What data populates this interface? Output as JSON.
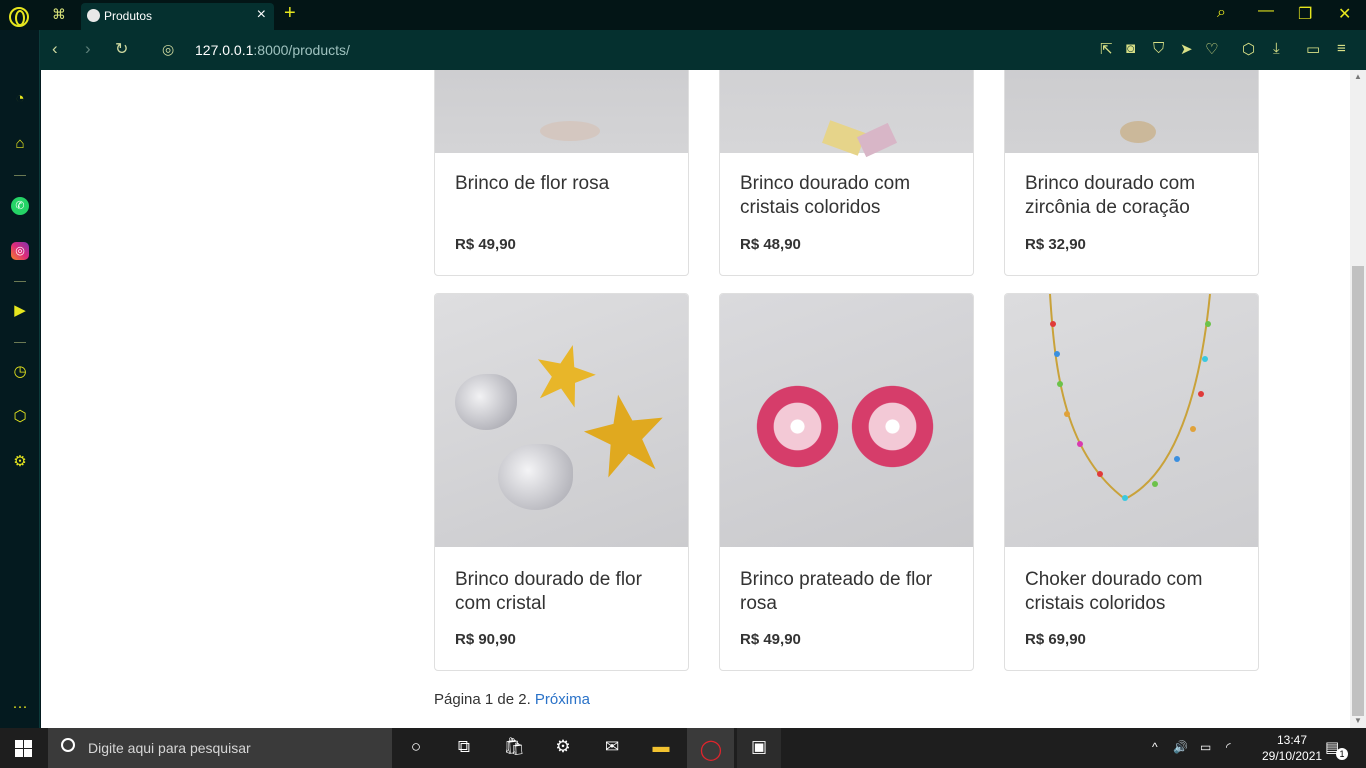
{
  "browser": {
    "tab_title": "Produtos",
    "new_tab_symbol": "+",
    "url_host": "127.0.0.1",
    "url_rest": ":8000/products/"
  },
  "products": [
    {
      "name": "Brinco de flor rosa",
      "price": "R$ 49,90",
      "image_colors": [
        "#c9c9cc",
        "#d4c7c0"
      ]
    },
    {
      "name": "Brinco dourado com cristais coloridos",
      "price": "R$ 48,90",
      "image_colors": [
        "#cfcfd1",
        "#d8c690"
      ]
    },
    {
      "name": "Brinco dourado com zircônia de coração",
      "price": "R$ 32,90",
      "image_colors": [
        "#c9c9cc",
        "#cbb89a"
      ]
    },
    {
      "name": "Brinco dourado de flor com cristal",
      "price": "R$ 90,90",
      "image_colors": [
        "#d4d4d7",
        "#e8b629"
      ]
    },
    {
      "name": "Brinco prateado de flor rosa",
      "price": "R$ 49,90",
      "image_colors": [
        "#d0d0d3",
        "#d63d6a"
      ]
    },
    {
      "name": "Choker dourado com cristais coloridos",
      "price": "R$ 69,90",
      "image_colors": [
        "#d2d2d5",
        "#c9a23a"
      ]
    }
  ],
  "pagination": {
    "prefix": "Página 1 de 2.",
    "next_label": "Próxima"
  },
  "taskbar": {
    "search_placeholder": "Digite aqui para pesquisar",
    "time": "13:47",
    "date": "29/10/2021",
    "notification_count": "1"
  }
}
